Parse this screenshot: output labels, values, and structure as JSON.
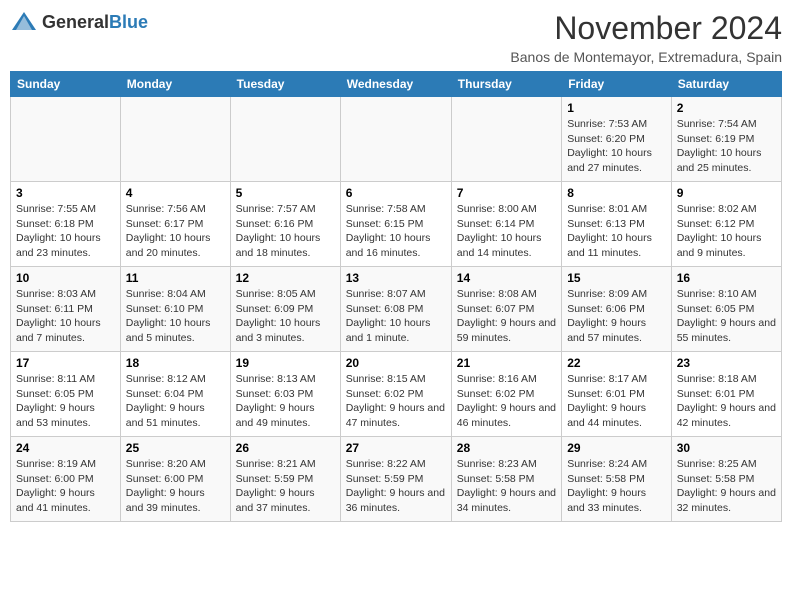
{
  "header": {
    "logo": {
      "text_general": "General",
      "text_blue": "Blue"
    },
    "month_year": "November 2024",
    "subtitle": "Banos de Montemayor, Extremadura, Spain"
  },
  "calendar": {
    "days_of_week": [
      "Sunday",
      "Monday",
      "Tuesday",
      "Wednesday",
      "Thursday",
      "Friday",
      "Saturday"
    ],
    "weeks": [
      [
        {
          "day": "",
          "info": ""
        },
        {
          "day": "",
          "info": ""
        },
        {
          "day": "",
          "info": ""
        },
        {
          "day": "",
          "info": ""
        },
        {
          "day": "",
          "info": ""
        },
        {
          "day": "1",
          "info": "Sunrise: 7:53 AM\nSunset: 6:20 PM\nDaylight: 10 hours and 27 minutes."
        },
        {
          "day": "2",
          "info": "Sunrise: 7:54 AM\nSunset: 6:19 PM\nDaylight: 10 hours and 25 minutes."
        }
      ],
      [
        {
          "day": "3",
          "info": "Sunrise: 7:55 AM\nSunset: 6:18 PM\nDaylight: 10 hours and 23 minutes."
        },
        {
          "day": "4",
          "info": "Sunrise: 7:56 AM\nSunset: 6:17 PM\nDaylight: 10 hours and 20 minutes."
        },
        {
          "day": "5",
          "info": "Sunrise: 7:57 AM\nSunset: 6:16 PM\nDaylight: 10 hours and 18 minutes."
        },
        {
          "day": "6",
          "info": "Sunrise: 7:58 AM\nSunset: 6:15 PM\nDaylight: 10 hours and 16 minutes."
        },
        {
          "day": "7",
          "info": "Sunrise: 8:00 AM\nSunset: 6:14 PM\nDaylight: 10 hours and 14 minutes."
        },
        {
          "day": "8",
          "info": "Sunrise: 8:01 AM\nSunset: 6:13 PM\nDaylight: 10 hours and 11 minutes."
        },
        {
          "day": "9",
          "info": "Sunrise: 8:02 AM\nSunset: 6:12 PM\nDaylight: 10 hours and 9 minutes."
        }
      ],
      [
        {
          "day": "10",
          "info": "Sunrise: 8:03 AM\nSunset: 6:11 PM\nDaylight: 10 hours and 7 minutes."
        },
        {
          "day": "11",
          "info": "Sunrise: 8:04 AM\nSunset: 6:10 PM\nDaylight: 10 hours and 5 minutes."
        },
        {
          "day": "12",
          "info": "Sunrise: 8:05 AM\nSunset: 6:09 PM\nDaylight: 10 hours and 3 minutes."
        },
        {
          "day": "13",
          "info": "Sunrise: 8:07 AM\nSunset: 6:08 PM\nDaylight: 10 hours and 1 minute."
        },
        {
          "day": "14",
          "info": "Sunrise: 8:08 AM\nSunset: 6:07 PM\nDaylight: 9 hours and 59 minutes."
        },
        {
          "day": "15",
          "info": "Sunrise: 8:09 AM\nSunset: 6:06 PM\nDaylight: 9 hours and 57 minutes."
        },
        {
          "day": "16",
          "info": "Sunrise: 8:10 AM\nSunset: 6:05 PM\nDaylight: 9 hours and 55 minutes."
        }
      ],
      [
        {
          "day": "17",
          "info": "Sunrise: 8:11 AM\nSunset: 6:05 PM\nDaylight: 9 hours and 53 minutes."
        },
        {
          "day": "18",
          "info": "Sunrise: 8:12 AM\nSunset: 6:04 PM\nDaylight: 9 hours and 51 minutes."
        },
        {
          "day": "19",
          "info": "Sunrise: 8:13 AM\nSunset: 6:03 PM\nDaylight: 9 hours and 49 minutes."
        },
        {
          "day": "20",
          "info": "Sunrise: 8:15 AM\nSunset: 6:02 PM\nDaylight: 9 hours and 47 minutes."
        },
        {
          "day": "21",
          "info": "Sunrise: 8:16 AM\nSunset: 6:02 PM\nDaylight: 9 hours and 46 minutes."
        },
        {
          "day": "22",
          "info": "Sunrise: 8:17 AM\nSunset: 6:01 PM\nDaylight: 9 hours and 44 minutes."
        },
        {
          "day": "23",
          "info": "Sunrise: 8:18 AM\nSunset: 6:01 PM\nDaylight: 9 hours and 42 minutes."
        }
      ],
      [
        {
          "day": "24",
          "info": "Sunrise: 8:19 AM\nSunset: 6:00 PM\nDaylight: 9 hours and 41 minutes."
        },
        {
          "day": "25",
          "info": "Sunrise: 8:20 AM\nSunset: 6:00 PM\nDaylight: 9 hours and 39 minutes."
        },
        {
          "day": "26",
          "info": "Sunrise: 8:21 AM\nSunset: 5:59 PM\nDaylight: 9 hours and 37 minutes."
        },
        {
          "day": "27",
          "info": "Sunrise: 8:22 AM\nSunset: 5:59 PM\nDaylight: 9 hours and 36 minutes."
        },
        {
          "day": "28",
          "info": "Sunrise: 8:23 AM\nSunset: 5:58 PM\nDaylight: 9 hours and 34 minutes."
        },
        {
          "day": "29",
          "info": "Sunrise: 8:24 AM\nSunset: 5:58 PM\nDaylight: 9 hours and 33 minutes."
        },
        {
          "day": "30",
          "info": "Sunrise: 8:25 AM\nSunset: 5:58 PM\nDaylight: 9 hours and 32 minutes."
        }
      ]
    ]
  }
}
